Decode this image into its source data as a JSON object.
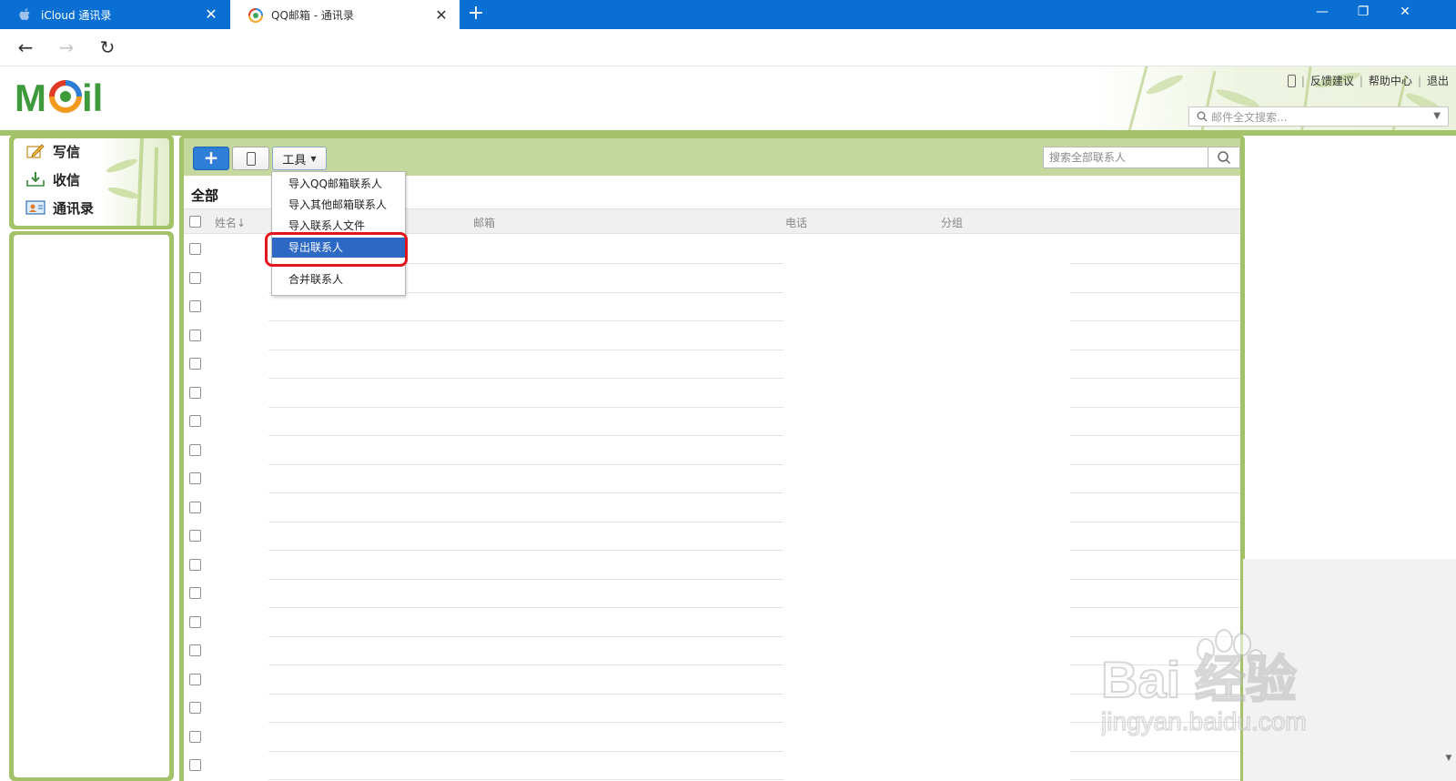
{
  "browser": {
    "tabs": [
      {
        "title": "iCloud 通讯录",
        "icon": "apple-icon",
        "active": false
      },
      {
        "title": "QQ邮箱 - 通讯录",
        "icon": "qqmail-icon",
        "active": true
      }
    ],
    "window_controls": {
      "minimize": "—",
      "restore": "❐",
      "close": "✕"
    }
  },
  "header": {
    "logo_text": "MAil",
    "links": [
      "反馈建议",
      "帮助中心",
      "退出"
    ],
    "mail_search_placeholder": "邮件全文搜索..."
  },
  "sidebar": {
    "items": [
      {
        "label": "写信",
        "icon": "compose-icon"
      },
      {
        "label": "收信",
        "icon": "inbox-download-icon"
      },
      {
        "label": "通讯录",
        "icon": "address-book-icon"
      }
    ]
  },
  "toolbar": {
    "add_label": "+",
    "tools_label": "工具",
    "contact_search_placeholder": "搜索全部联系人"
  },
  "main": {
    "group_title": "全部",
    "columns": {
      "name": "姓名↓",
      "email": "邮箱",
      "phone": "电话",
      "group": "分组"
    },
    "row_count": 19
  },
  "tools_menu": {
    "items": [
      {
        "label": "导入QQ邮箱联系人",
        "selected": false
      },
      {
        "label": "导入其他邮箱联系人",
        "selected": false
      },
      {
        "label": "导入联系人文件",
        "selected": false
      },
      {
        "label": "导出联系人",
        "selected": true
      },
      {
        "label": "合并联系人",
        "selected": false
      }
    ]
  },
  "watermark": {
    "text": "Bai 经验",
    "subtext": "jingyan.baidu.com"
  },
  "colors": {
    "browser_blue": "#0a6fd3",
    "mail_green": "#a4c26a",
    "toolbar_green": "#c5d89d",
    "menu_selected": "#2d68c4",
    "highlight_red": "#e4141c"
  }
}
